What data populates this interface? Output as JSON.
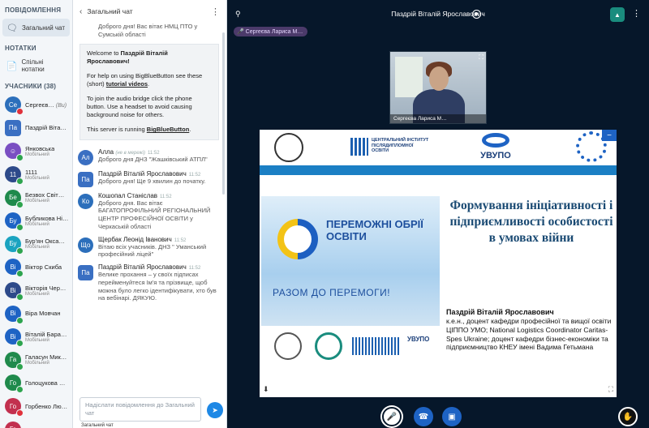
{
  "sidebar": {
    "messages_title": "ПОВІДОМЛЕННЯ",
    "public_chat": "Загальний чат",
    "notes_title": "НОТАТКИ",
    "shared_notes": "Спільні нотатки",
    "participants_title": "УЧАСНИКИ (38)",
    "users": [
      {
        "initials": "Се",
        "name": "Сергеєв…",
        "role": "(Ви)",
        "color": "#2c6fbb",
        "square": false,
        "mic": "red"
      },
      {
        "initials": "Па",
        "name": "Паздрій Віта…",
        "role": "",
        "color": "#3a6fc2",
        "square": true,
        "mic": "none"
      },
      {
        "initials": "",
        "name": "Янковська",
        "role": "Мобільний",
        "color": "#7a4fc2",
        "square": false,
        "mic": "green",
        "avatar": "person"
      },
      {
        "initials": "11",
        "name": "1111",
        "role": "Мобільний",
        "color": "#2d4a8a",
        "square": false,
        "mic": "green"
      },
      {
        "initials": "Бе",
        "name": "Безвох Світ…",
        "role": "Мобільний",
        "color": "#1f8a4c",
        "square": false,
        "mic": "green"
      },
      {
        "initials": "Бу",
        "name": "Бубликова Ні…",
        "role": "Мобільний",
        "color": "#1e63c4",
        "square": false,
        "mic": "green"
      },
      {
        "initials": "Бу",
        "name": "Бур'ян Окса…",
        "role": "Мобільний",
        "color": "#1aa3c0",
        "square": false,
        "mic": "green"
      },
      {
        "initials": "Ві",
        "name": "Віктор Скиба",
        "role": "",
        "color": "#1e63c4",
        "square": false,
        "mic": "green"
      },
      {
        "initials": "Ві",
        "name": "Вікторія Чер…",
        "role": "Мобільний",
        "color": "#2d4a8a",
        "square": false,
        "mic": "green"
      },
      {
        "initials": "Ві",
        "name": "Віра Мовчан",
        "role": "",
        "color": "#1e63c4",
        "square": false,
        "mic": "green"
      },
      {
        "initials": "Ві",
        "name": "Віталій Бара…",
        "role": "Мобільний",
        "color": "#1e63c4",
        "square": false,
        "mic": "green"
      },
      {
        "initials": "Га",
        "name": "Галасун Мик…",
        "role": "Мобільний",
        "color": "#1f8a4c",
        "square": false,
        "mic": "green"
      },
      {
        "initials": "Го",
        "name": "Голоцукова …",
        "role": "",
        "color": "#1f8a4c",
        "square": false,
        "mic": "green"
      },
      {
        "initials": "Го",
        "name": "Горбенко Лю…",
        "role": "",
        "color": "#c2304f",
        "square": false,
        "mic": "red"
      },
      {
        "initials": "Го",
        "name": "…",
        "role": "",
        "color": "#c2304f",
        "square": false,
        "mic": "none"
      }
    ]
  },
  "chat": {
    "title": "Загальний чат",
    "first_text": "Доброго дня! Вас вітає НМЦ ПТО у Сумській області",
    "welcome": {
      "p1_prefix": "Welcome to ",
      "p1_name": "Паздрій Віталій Ярославович",
      "p1_suffix": "!",
      "p2_prefix": "For help on using BigBlueButton see these (short) ",
      "p2_link": "tutorial videos",
      "p2_suffix": ".",
      "p3": "To join the audio bridge click the phone button. Use a headset to avoid causing background noise for others.",
      "p4_prefix": "This server is running ",
      "p4_link": "BigBlueButton",
      "p4_suffix": "."
    },
    "messages": [
      {
        "initials": "Ал",
        "color": "#3a6fc2",
        "square": false,
        "name": "Алла",
        "hint": "(не в мережі)",
        "time": "11:52",
        "text": "Доброго дня ДНЗ \"Жашківський АТПЛ\""
      },
      {
        "initials": "Па",
        "color": "#3a6fc2",
        "square": true,
        "name": "Паздрій Віталій Ярославович",
        "hint": "",
        "time": "11:52",
        "text": "Доброго дня! Ще 9 хвилин до початку."
      },
      {
        "initials": "Ко",
        "color": "#2c6fbb",
        "square": false,
        "name": "Кошопал Станіслав",
        "hint": "",
        "time": "11:52",
        "text": "Доброго дня. Вас вітає БАГАТОПРОФІЛЬНИЙ РЕГІОНАЛЬНИЙ ЦЕНТР ПРОФЕСІЙНОЇ ОСВІТИ у Черкаській області"
      },
      {
        "initials": "Що",
        "color": "#2c6fbb",
        "square": false,
        "name": "Щербак Леонід Іванович",
        "hint": "",
        "time": "11:52",
        "text": "Вітаю всіх учасників. ДНЗ \" Уманський професійний ліцей\""
      },
      {
        "initials": "Па",
        "color": "#3a6fc2",
        "square": true,
        "name": "Паздрій Віталій Ярославович",
        "hint": "",
        "time": "11:52",
        "text": "Велике прохання – у своїх підписах перейменуйтеся Ім'я та прізвище, щоб можна було легко ідентифікувати, хто був на вебінарі. ДЯКУЮ."
      }
    ],
    "input_placeholder": "Надіслати повідомлення до Загальний чат",
    "typing": "Загальний чат"
  },
  "main": {
    "presenter_title": "Паздрій Віталій Ярославович",
    "talking": "Сергеєва Лариса М…",
    "webcam_name": "Сергеєва Лариса М…"
  },
  "slide": {
    "logo_text": "ЦЕНТРАЛЬНИЙ ІНСТИТУТ ПІСЛЯДИПЛОМНОЇ ОСВІТИ",
    "uvupo": "УВУПО",
    "poster_title": "ПЕРЕМОЖНІ ОБРІЇ ОСВІТИ",
    "poster_sub": "РАЗОМ ДО ПЕРЕМОГИ!",
    "title": "Формування ініціативності і підприємливості особистості в умовах війни",
    "author_name": "Паздрій Віталій Ярославович",
    "author_lines": "к.е.н., доцент кафедри професійної та вищої освіти ЦІППО УМО; National Logistics Coordinator Caritas-Spes Ukraine; доцент кафедри бізнес-економіки та підприємництво КНЕУ імені Вадима Гетьмана",
    "bottom_uvupo": "УВУПО"
  }
}
